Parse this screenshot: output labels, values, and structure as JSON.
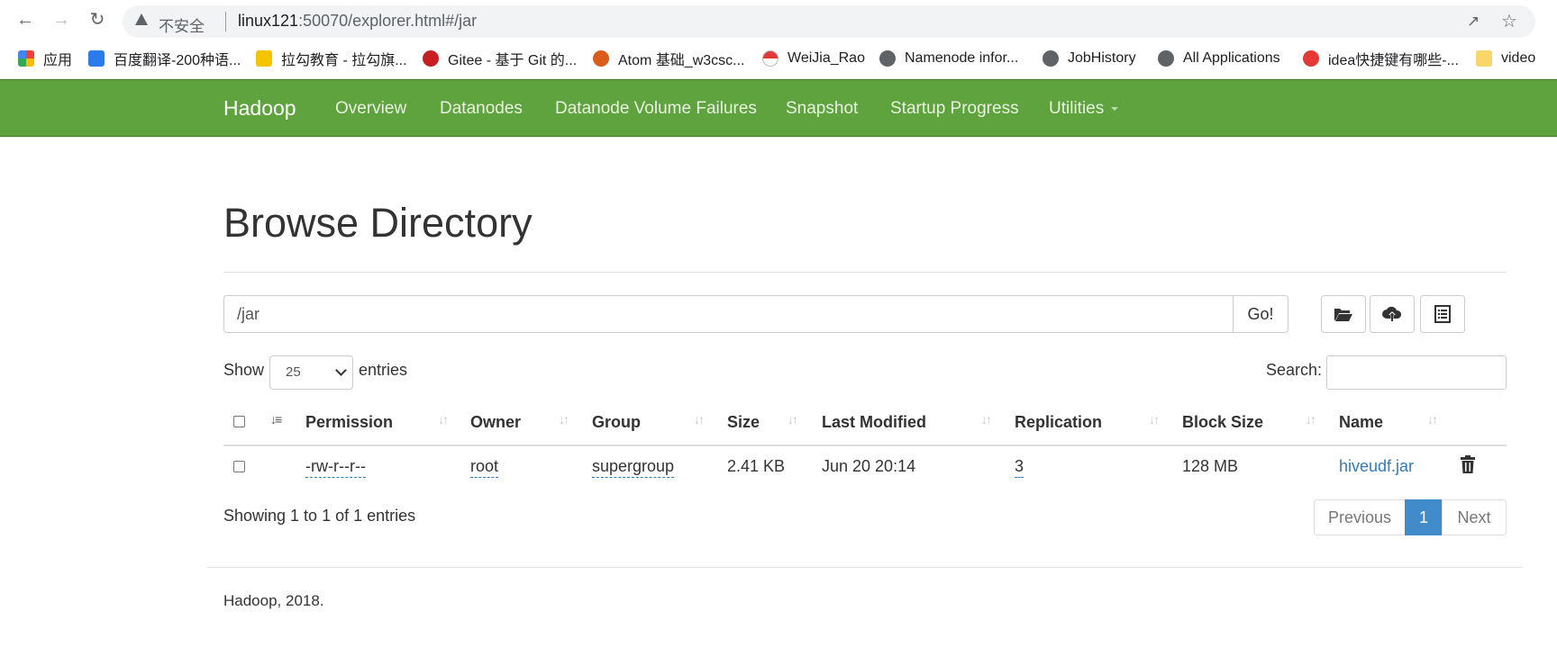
{
  "browser": {
    "security_label": "不安全",
    "url_host": "linux121",
    "url_rest": ":50070/explorer.html#/jar",
    "bookmarks": [
      {
        "label": "应用",
        "icon": "apps-grid-icon",
        "color": "#ea4335"
      },
      {
        "label": "百度翻译-200种语...",
        "icon": "baidu-translate-icon",
        "color": "#2b7bef"
      },
      {
        "label": "拉勾教育 - 拉勾旗...",
        "icon": "lagou-icon",
        "color": "#f5c400"
      },
      {
        "label": "Gitee - 基于 Git 的...",
        "icon": "gitee-icon",
        "color": "#c71d23"
      },
      {
        "label": "Atom 基础_w3csc...",
        "icon": "atom-icon",
        "color": "#d95c1a"
      },
      {
        "label": "WeiJia_Rao",
        "icon": "pokeball-icon",
        "color": "#e53935"
      },
      {
        "label": "Namenode infor...",
        "icon": "globe-icon",
        "color": "#5f6368"
      },
      {
        "label": "JobHistory",
        "icon": "globe-icon",
        "color": "#5f6368"
      },
      {
        "label": "All Applications",
        "icon": "globe-icon",
        "color": "#5f6368"
      },
      {
        "label": "idea快捷键有哪些-...",
        "icon": "php-icon",
        "color": "#e53935"
      },
      {
        "label": "video",
        "icon": "folder-icon",
        "color": "#f9d66a"
      }
    ]
  },
  "navbar": {
    "brand": "Hadoop",
    "items": [
      "Overview",
      "Datanodes",
      "Datanode Volume Failures",
      "Snapshot",
      "Startup Progress",
      "Utilities"
    ],
    "color": "#5fa33e"
  },
  "main": {
    "title": "Browse Directory",
    "path_value": "/jar",
    "go_label": "Go!",
    "show_label": "Show",
    "entries_value": "25",
    "entries_label": "entries",
    "search_label": "Search:",
    "columns": [
      "Permission",
      "Owner",
      "Group",
      "Size",
      "Last Modified",
      "Replication",
      "Block Size",
      "Name"
    ],
    "rows": [
      {
        "permission": "-rw-r--r--",
        "owner": "root",
        "group": "supergroup",
        "size": "2.41 KB",
        "last_modified": "Jun 20 20:14",
        "replication": "3",
        "block_size": "128 MB",
        "name": "hiveudf.jar"
      }
    ],
    "showing_text": "Showing 1 to 1 of 1 entries",
    "pagination": {
      "previous": "Previous",
      "current": "1",
      "next": "Next"
    },
    "accent_color": "#428bca"
  },
  "footer": {
    "text": "Hadoop, 2018."
  }
}
